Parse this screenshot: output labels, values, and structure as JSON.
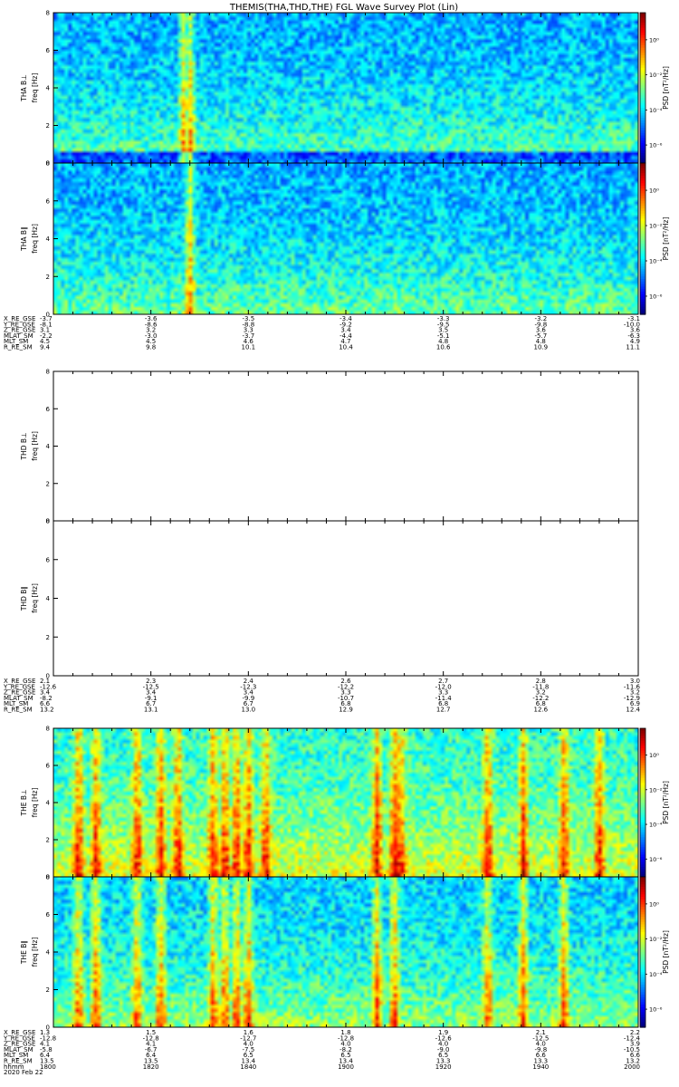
{
  "title": "THEMIS(THA,THD,THE) FGL Wave Survey Plot (Lin)",
  "colors": {
    "frame": "#000000",
    "background": "#ffffff"
  },
  "chart_data": [
    {
      "type": "heatmap",
      "probe": "THA",
      "ylabel_probe": "THA B⊥",
      "ylabel_unit": "freq [Hz]",
      "ylim": [
        0,
        8
      ],
      "yticks": [
        "0",
        "2",
        "4",
        "6",
        "8"
      ],
      "has_data": true,
      "colorbar": {
        "label": "PSD [nT²/Hz]",
        "ticks": [
          "10⁰",
          "10⁻²",
          "10⁻⁴",
          "10⁻⁶"
        ],
        "log": true
      },
      "features": {
        "broadband_bursts": [
          0.22,
          0.23
        ],
        "background_level": "low",
        "baseline_line": true
      }
    },
    {
      "type": "heatmap",
      "probe": "THA",
      "ylabel_probe": "THA B∥",
      "ylabel_unit": "freq [Hz]",
      "ylim": [
        0,
        8
      ],
      "yticks": [
        "0",
        "2",
        "4",
        "6",
        "8"
      ],
      "has_data": true,
      "colorbar": {
        "label": "PSD [nT²/Hz]",
        "ticks": [
          "10⁰",
          "10⁻²",
          "10⁻⁴",
          "10⁻⁶"
        ],
        "log": true
      },
      "features": {
        "broadband_bursts": [
          0.23
        ],
        "background_level": "low"
      }
    },
    {
      "type": "heatmap",
      "probe": "THD",
      "ylabel_probe": "THD B⊥",
      "ylabel_unit": "freq [Hz]",
      "ylim": [
        0,
        8
      ],
      "yticks": [
        "0",
        "2",
        "4",
        "6",
        "8"
      ],
      "has_data": false
    },
    {
      "type": "heatmap",
      "probe": "THD",
      "ylabel_probe": "THD B∥",
      "ylabel_unit": "freq [Hz]",
      "ylim": [
        0,
        8
      ],
      "yticks": [
        "0",
        "2",
        "4",
        "6",
        "8"
      ],
      "has_data": false
    },
    {
      "type": "heatmap",
      "probe": "THE",
      "ylabel_probe": "THE B⊥",
      "ylabel_unit": "freq [Hz]",
      "ylim": [
        0,
        8
      ],
      "yticks": [
        "0",
        "2",
        "4",
        "6",
        "8"
      ],
      "has_data": true,
      "colorbar": {
        "label": "PSD [nT²/Hz]",
        "ticks": [
          "10⁰",
          "10⁻²",
          "10⁻⁴",
          "10⁻⁶"
        ],
        "log": true
      },
      "features": {
        "broadband_bursts": [
          0.04,
          0.07,
          0.14,
          0.18,
          0.21,
          0.27,
          0.29,
          0.31,
          0.33,
          0.36,
          0.55,
          0.58,
          0.59,
          0.74,
          0.8,
          0.87,
          0.93
        ],
        "background_level": "high"
      }
    },
    {
      "type": "heatmap",
      "probe": "THE",
      "ylabel_probe": "THE B∥",
      "ylabel_unit": "freq [Hz]",
      "ylim": [
        0,
        8
      ],
      "yticks": [
        "0",
        "2",
        "4",
        "6",
        "8"
      ],
      "has_data": true,
      "colorbar": {
        "label": "PSD [nT²/Hz]",
        "ticks": [
          "10⁰",
          "10⁻²",
          "10⁻⁴",
          "10⁻⁶"
        ],
        "log": true
      },
      "features": {
        "broadband_bursts": [
          0.04,
          0.07,
          0.14,
          0.18,
          0.27,
          0.29,
          0.31,
          0.33,
          0.55,
          0.58,
          0.74,
          0.8,
          0.87
        ],
        "background_level": "medium"
      }
    }
  ],
  "ephemeris": [
    {
      "labels": [
        "X_RE_GSE",
        "Y_RE_GSE",
        "Z_RE_GSE",
        "MLAT_SM",
        "MLT_SM",
        "R_RE_SM"
      ],
      "rows": [
        [
          "-3.7",
          "-3.6",
          "-3.5",
          "-3.4",
          "-3.3",
          "-3.2",
          "-3.1"
        ],
        [
          "-8.1",
          "-8.6",
          "-8.8",
          "-9.2",
          "-9.5",
          "-9.8",
          "-10.0"
        ],
        [
          "3.1",
          "3.2",
          "3.3",
          "3.4",
          "3.5",
          "3.6",
          "3.6"
        ],
        [
          "-2.2",
          "-3.0",
          "-3.7",
          "-4.4",
          "-5.1",
          "-5.7",
          "-6.3"
        ],
        [
          "4.5",
          "4.5",
          "4.6",
          "4.7",
          "4.8",
          "4.8",
          "4.9"
        ],
        [
          "9.4",
          "9.8",
          "10.1",
          "10.4",
          "10.6",
          "10.9",
          "11.1"
        ]
      ]
    },
    {
      "labels": [
        "X_RE_GSE",
        "Y_RE_GSE",
        "Z_RE_GSE",
        "MLAT_SM",
        "MLT_SM",
        "R_RE_SM"
      ],
      "rows": [
        [
          "2.1",
          "2.3",
          "2.4",
          "2.6",
          "2.7",
          "2.8",
          "3.0"
        ],
        [
          "-12.6",
          "-12.5",
          "-12.3",
          "-12.2",
          "-12.0",
          "-11.8",
          "-11.6"
        ],
        [
          "3.4",
          "3.4",
          "3.4",
          "3.3",
          "3.3",
          "3.2",
          "3.2"
        ],
        [
          "-8.2",
          "-9.1",
          "-9.9",
          "-10.7",
          "-11.4",
          "-12.2",
          "-12.9"
        ],
        [
          "6.6",
          "6.7",
          "6.7",
          "6.8",
          "6.8",
          "6.8",
          "6.9"
        ],
        [
          "13.2",
          "13.1",
          "13.0",
          "12.9",
          "12.7",
          "12.6",
          "12.4"
        ]
      ]
    },
    {
      "labels": [
        "X_RE_GSE",
        "Y_RE_GSE",
        "Z_RE_GSE",
        "MLAT_SM",
        "MLT_SM",
        "R_RE_SM",
        "hhmm",
        "2020 Feb 22"
      ],
      "rows": [
        [
          "1.3",
          "1.5",
          "1.6",
          "1.8",
          "1.9",
          "2.1",
          "2.2"
        ],
        [
          "-12.8",
          "-12.8",
          "-12.7",
          "-12.8",
          "-12.6",
          "-12.5",
          "-12.4"
        ],
        [
          "4.1",
          "4.1",
          "4.0",
          "4.0",
          "4.0",
          "4.0",
          "3.9"
        ],
        [
          "-5.8",
          "-6.7",
          "-7.5",
          "-8.2",
          "-9.0",
          "-9.8",
          "-10.5"
        ],
        [
          "6.4",
          "6.4",
          "6.5",
          "6.5",
          "6.5",
          "6.6",
          "6.6"
        ],
        [
          "13.5",
          "13.5",
          "13.4",
          "13.4",
          "13.3",
          "13.3",
          "13.2"
        ],
        [
          "1800",
          "1820",
          "1840",
          "1900",
          "1920",
          "1940",
          "2000"
        ]
      ]
    }
  ]
}
